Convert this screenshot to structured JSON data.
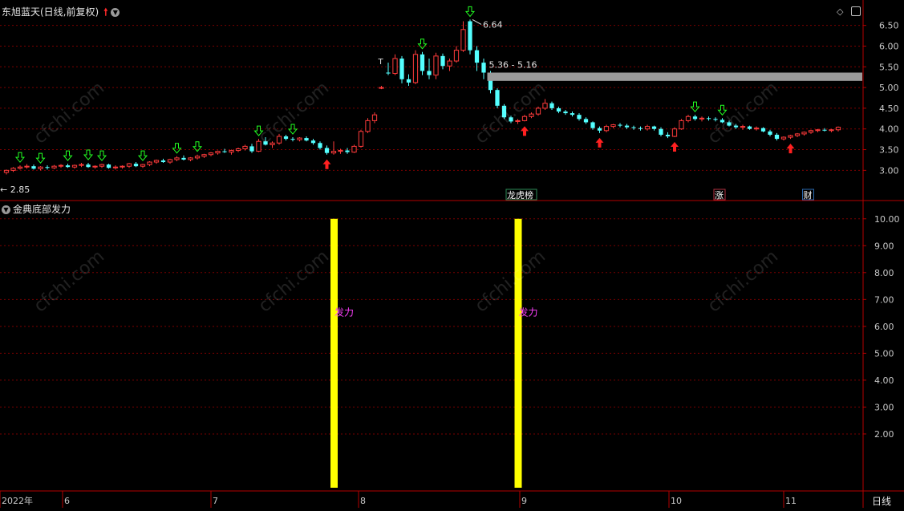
{
  "header": {
    "title": "东旭蓝天(日线,前复权)",
    "up_arrow_icon": "red-up-arrow",
    "menu_icon": "chevron-down-circle"
  },
  "indicator": {
    "title": "金典底部发力",
    "menu_icon": "chevron-down-circle"
  },
  "controls": {
    "diamond_icon": "diamond-icon",
    "panel_icon": "panel-icon"
  },
  "price_axis": [
    "6.50",
    "6.00",
    "5.50",
    "5.00",
    "4.50",
    "4.00",
    "3.50",
    "3.00"
  ],
  "indicator_axis": [
    "10.00",
    "9.00",
    "8.00",
    "7.00",
    "6.00",
    "5.00",
    "4.00",
    "3.00",
    "2.00"
  ],
  "time_axis": [
    "2022年",
    "6",
    "7",
    "8",
    "9",
    "10",
    "11"
  ],
  "period_label": "日线",
  "annotations": {
    "high": "6.64",
    "low": "2.85",
    "zone": "5.36 - 5.16",
    "T_mark": "T",
    "signal_text": "发力",
    "badges": [
      {
        "text": "龙虎榜",
        "color": "#2e8b57"
      },
      {
        "text": "涨",
        "color": "#b03040"
      },
      {
        "text": "财",
        "color": "#2a6ab0"
      }
    ]
  },
  "watermark": "cfchi.com",
  "colors": {
    "up": "#ff3b3b",
    "down": "#54ffff",
    "grid": "#7a0000",
    "border": "#b40000",
    "signal": "#ffff00",
    "zone": "#9a9a9a",
    "buy_arrow": "#ff2020",
    "sell_arrow": "#22ff22",
    "signal_text": "#ff40ff"
  },
  "chart_data": {
    "type": "candlestick",
    "ylim_price": [
      2.6,
      6.9
    ],
    "ylim_indicator": [
      0,
      10.5
    ],
    "candles": [
      [
        2.95,
        3.02,
        2.9,
        3.0
      ],
      [
        3.0,
        3.08,
        2.96,
        3.05
      ],
      [
        3.05,
        3.12,
        3.02,
        3.08
      ],
      [
        3.08,
        3.15,
        3.04,
        3.1
      ],
      [
        3.1,
        3.14,
        3.02,
        3.04
      ],
      [
        3.04,
        3.1,
        3.0,
        3.08
      ],
      [
        3.08,
        3.12,
        3.02,
        3.06
      ],
      [
        3.06,
        3.13,
        3.03,
        3.1
      ],
      [
        3.1,
        3.15,
        3.06,
        3.12
      ],
      [
        3.12,
        3.16,
        3.06,
        3.08
      ],
      [
        3.08,
        3.14,
        3.04,
        3.12
      ],
      [
        3.12,
        3.18,
        3.08,
        3.14
      ],
      [
        3.14,
        3.18,
        3.06,
        3.08
      ],
      [
        3.08,
        3.12,
        3.04,
        3.1
      ],
      [
        3.1,
        3.16,
        3.06,
        3.14
      ],
      [
        3.14,
        3.16,
        3.04,
        3.06
      ],
      [
        3.06,
        3.12,
        3.02,
        3.08
      ],
      [
        3.08,
        3.12,
        3.04,
        3.1
      ],
      [
        3.1,
        3.18,
        3.06,
        3.16
      ],
      [
        3.16,
        3.2,
        3.08,
        3.1
      ],
      [
        3.1,
        3.16,
        3.06,
        3.14
      ],
      [
        3.14,
        3.22,
        3.1,
        3.2
      ],
      [
        3.2,
        3.26,
        3.16,
        3.24
      ],
      [
        3.24,
        3.28,
        3.18,
        3.2
      ],
      [
        3.2,
        3.28,
        3.16,
        3.26
      ],
      [
        3.26,
        3.34,
        3.22,
        3.3
      ],
      [
        3.3,
        3.36,
        3.24,
        3.26
      ],
      [
        3.26,
        3.32,
        3.22,
        3.3
      ],
      [
        3.3,
        3.38,
        3.26,
        3.34
      ],
      [
        3.34,
        3.4,
        3.3,
        3.38
      ],
      [
        3.38,
        3.44,
        3.34,
        3.42
      ],
      [
        3.42,
        3.48,
        3.38,
        3.46
      ],
      [
        3.46,
        3.52,
        3.42,
        3.44
      ],
      [
        3.44,
        3.5,
        3.38,
        3.48
      ],
      [
        3.48,
        3.55,
        3.44,
        3.52
      ],
      [
        3.52,
        3.62,
        3.48,
        3.58
      ],
      [
        3.58,
        3.64,
        3.42,
        3.46
      ],
      [
        3.46,
        3.76,
        3.44,
        3.7
      ],
      [
        3.7,
        3.8,
        3.6,
        3.62
      ],
      [
        3.62,
        3.7,
        3.54,
        3.66
      ],
      [
        3.66,
        3.88,
        3.62,
        3.82
      ],
      [
        3.82,
        3.86,
        3.72,
        3.76
      ],
      [
        3.76,
        3.8,
        3.7,
        3.74
      ],
      [
        3.74,
        3.8,
        3.7,
        3.78
      ],
      [
        3.78,
        3.82,
        3.7,
        3.72
      ],
      [
        3.72,
        3.76,
        3.62,
        3.66
      ],
      [
        3.66,
        3.7,
        3.5,
        3.54
      ],
      [
        3.54,
        3.6,
        3.38,
        3.42
      ],
      [
        3.42,
        3.7,
        3.38,
        3.46
      ],
      [
        3.46,
        3.52,
        3.4,
        3.48
      ],
      [
        3.48,
        3.54,
        3.4,
        3.44
      ],
      [
        3.44,
        3.62,
        3.42,
        3.58
      ],
      [
        3.58,
        3.98,
        3.55,
        3.94
      ],
      [
        3.94,
        4.26,
        3.9,
        4.2
      ],
      [
        4.2,
        4.4,
        4.14,
        4.34
      ],
      [
        5.0,
        5.04,
        4.96,
        5.0
      ],
      [
        5.36,
        5.6,
        5.3,
        5.34
      ],
      [
        5.34,
        5.8,
        5.3,
        5.7
      ],
      [
        5.7,
        5.76,
        5.1,
        5.2
      ],
      [
        5.2,
        5.32,
        5.04,
        5.12
      ],
      [
        5.12,
        5.9,
        5.08,
        5.8
      ],
      [
        5.8,
        5.86,
        5.3,
        5.4
      ],
      [
        5.4,
        5.7,
        5.2,
        5.3
      ],
      [
        5.3,
        5.84,
        5.2,
        5.76
      ],
      [
        5.76,
        5.82,
        5.44,
        5.52
      ],
      [
        5.52,
        5.7,
        5.4,
        5.64
      ],
      [
        5.64,
        6.0,
        5.6,
        5.9
      ],
      [
        5.9,
        6.6,
        5.86,
        6.4
      ],
      [
        6.6,
        6.64,
        5.8,
        5.9
      ],
      [
        5.9,
        6.0,
        5.4,
        5.6
      ],
      [
        5.6,
        5.7,
        5.2,
        5.36
      ],
      [
        5.36,
        5.4,
        4.86,
        4.94
      ],
      [
        4.94,
        4.98,
        4.5,
        4.56
      ],
      [
        4.56,
        4.6,
        4.24,
        4.28
      ],
      [
        4.28,
        4.32,
        4.14,
        4.18
      ],
      [
        4.18,
        4.24,
        4.12,
        4.2
      ],
      [
        4.2,
        4.34,
        4.18,
        4.3
      ],
      [
        4.3,
        4.4,
        4.26,
        4.36
      ],
      [
        4.36,
        4.54,
        4.32,
        4.5
      ],
      [
        4.5,
        4.72,
        4.46,
        4.62
      ],
      [
        4.62,
        4.66,
        4.46,
        4.5
      ],
      [
        4.5,
        4.54,
        4.38,
        4.42
      ],
      [
        4.42,
        4.46,
        4.34,
        4.38
      ],
      [
        4.38,
        4.42,
        4.3,
        4.34
      ],
      [
        4.34,
        4.38,
        4.2,
        4.24
      ],
      [
        4.24,
        4.28,
        4.12,
        4.16
      ],
      [
        4.16,
        4.18,
        3.98,
        4.02
      ],
      [
        4.02,
        4.06,
        3.9,
        3.96
      ],
      [
        3.96,
        4.1,
        3.92,
        4.06
      ],
      [
        4.06,
        4.12,
        4.02,
        4.1
      ],
      [
        4.1,
        4.14,
        4.04,
        4.08
      ],
      [
        4.08,
        4.12,
        4.0,
        4.04
      ],
      [
        4.04,
        4.08,
        3.98,
        4.02
      ],
      [
        4.02,
        4.06,
        3.96,
        4.0
      ],
      [
        4.0,
        4.1,
        3.96,
        4.06
      ],
      [
        4.06,
        4.08,
        3.96,
        4.0
      ],
      [
        4.0,
        4.04,
        3.82,
        3.86
      ],
      [
        3.86,
        3.92,
        3.78,
        3.82
      ],
      [
        3.82,
        4.04,
        3.8,
        4.0
      ],
      [
        4.0,
        4.24,
        3.98,
        4.2
      ],
      [
        4.2,
        4.34,
        4.16,
        4.3
      ],
      [
        4.3,
        4.34,
        4.2,
        4.24
      ],
      [
        4.24,
        4.3,
        4.18,
        4.26
      ],
      [
        4.26,
        4.3,
        4.2,
        4.24
      ],
      [
        4.24,
        4.28,
        4.18,
        4.22
      ],
      [
        4.22,
        4.26,
        4.14,
        4.16
      ],
      [
        4.16,
        4.2,
        4.06,
        4.08
      ],
      [
        4.08,
        4.12,
        4.0,
        4.04
      ],
      [
        4.04,
        4.1,
        3.98,
        4.06
      ],
      [
        4.06,
        4.08,
        3.98,
        4.0
      ],
      [
        4.0,
        4.06,
        3.96,
        4.02
      ],
      [
        4.02,
        4.04,
        3.92,
        3.94
      ],
      [
        3.94,
        3.98,
        3.82,
        3.86
      ],
      [
        3.86,
        3.9,
        3.72,
        3.76
      ],
      [
        3.76,
        3.82,
        3.72,
        3.8
      ],
      [
        3.8,
        3.86,
        3.76,
        3.84
      ],
      [
        3.84,
        3.9,
        3.8,
        3.88
      ],
      [
        3.88,
        3.94,
        3.84,
        3.92
      ],
      [
        3.92,
        3.98,
        3.88,
        3.96
      ],
      [
        3.96,
        4.0,
        3.92,
        3.98
      ],
      [
        3.98,
        4.02,
        3.94,
        3.96
      ],
      [
        3.96,
        4.0,
        3.92,
        3.98
      ],
      [
        3.98,
        4.06,
        3.94,
        4.04
      ]
    ],
    "buy_signal_candles": [
      47,
      76,
      87,
      98,
      115
    ],
    "sell_signal_candles": [
      2,
      5,
      9,
      12,
      14,
      20,
      25,
      28,
      37,
      42,
      61,
      68,
      101,
      105
    ],
    "indicator_bars": [
      {
        "candle": 48,
        "value": 10.0
      },
      {
        "candle": 75,
        "value": 10.0
      }
    ]
  }
}
